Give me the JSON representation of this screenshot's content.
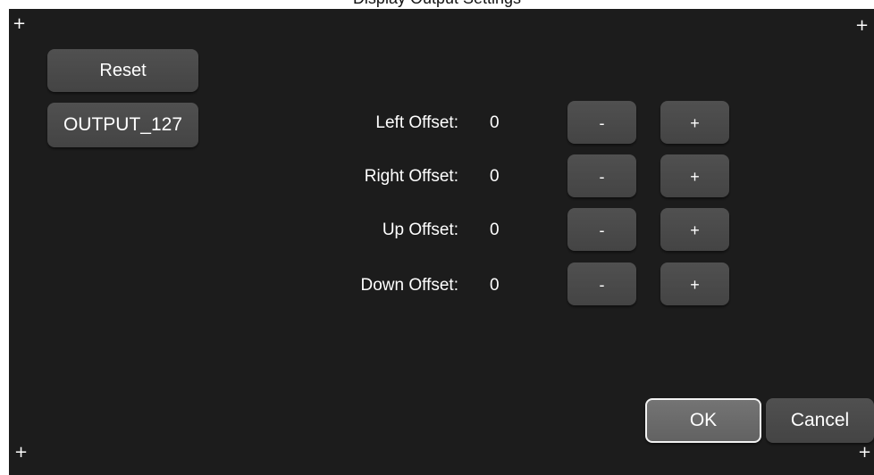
{
  "window": {
    "title": "Display Output Settings"
  },
  "corners": {
    "symbol": "+"
  },
  "left_buttons": {
    "reset": "Reset",
    "output": "OUTPUT_127"
  },
  "offsets": [
    {
      "label": "Left Offset:",
      "value": "0",
      "minus": "-",
      "plus": "+"
    },
    {
      "label": "Right Offset:",
      "value": "0",
      "minus": "-",
      "plus": "+"
    },
    {
      "label": "Up Offset:",
      "value": "0",
      "minus": "-",
      "plus": "+"
    },
    {
      "label": "Down Offset:",
      "value": "0",
      "minus": "-",
      "plus": "+"
    }
  ],
  "footer": {
    "ok": "OK",
    "cancel": "Cancel"
  }
}
